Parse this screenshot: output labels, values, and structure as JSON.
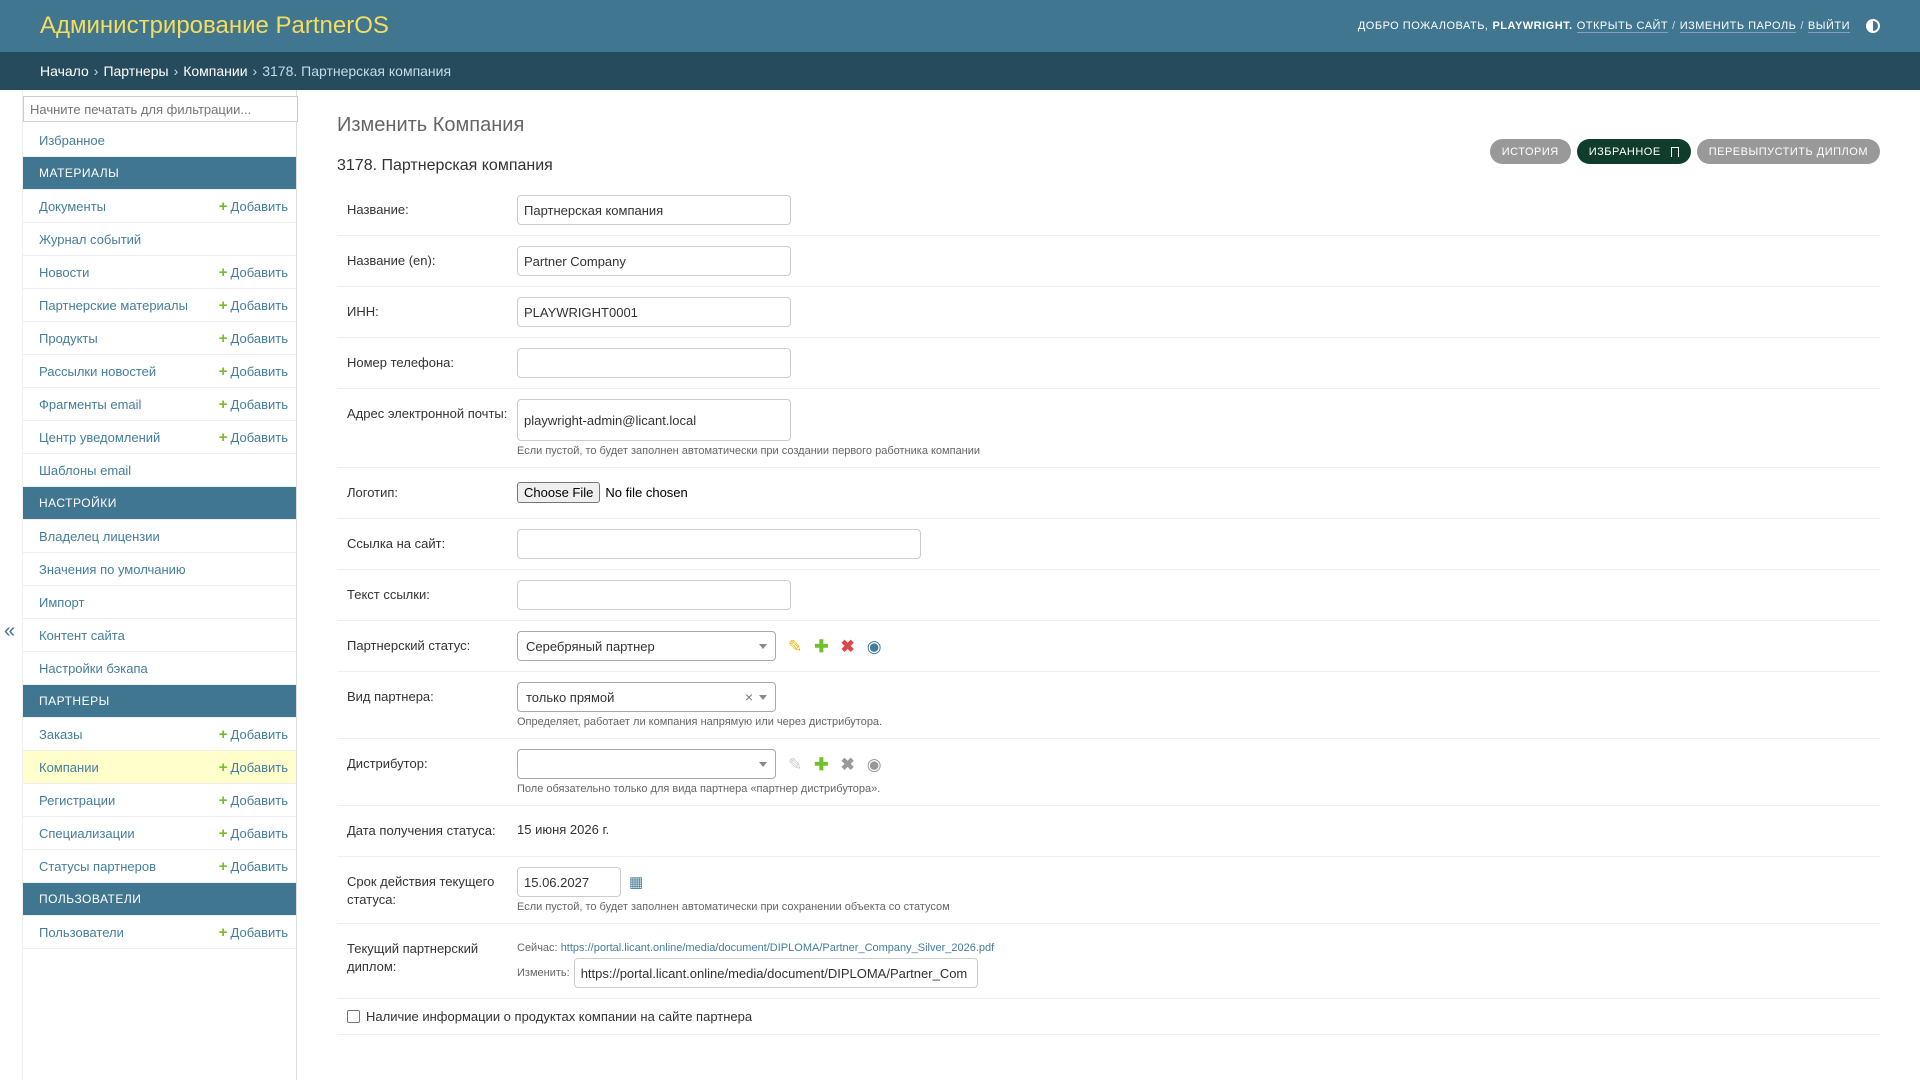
{
  "header": {
    "site_name": "Администрирование PartnerOS",
    "welcome": "ДОБРО ПОЖАЛОВАТЬ,",
    "username": "PLAYWRIGHT.",
    "view_site": "ОТКРЫТЬ САЙТ",
    "change_password": "ИЗМЕНИТЬ ПАРОЛЬ",
    "logout": "ВЫЙТИ",
    "separator": "/"
  },
  "breadcrumbs": {
    "home": "Начало",
    "partners": "Партнеры",
    "companies": "Компании",
    "current": "3178. Партнерская компания",
    "arrow": "›"
  },
  "sidebar": {
    "filter_placeholder": "Начните печатать для фильтрации...",
    "favorites": "Избранное",
    "add_label": "Добавить",
    "sections": {
      "materials": "МАТЕРИАЛЫ",
      "settings": "НАСТРОЙКИ",
      "partners": "ПАРТНЕРЫ",
      "users": "ПОЛЬЗОВАТЕЛИ"
    },
    "materials_items": [
      "Документы",
      "Журнал событий",
      "Новости",
      "Партнерские материалы",
      "Продукты",
      "Рассылки новостей",
      "Фрагменты email",
      "Центр уведомлений",
      "Шаблоны email"
    ],
    "settings_items": [
      "Владелец лицензии",
      "Значения по умолчанию",
      "Импорт",
      "Контент сайта",
      "Настройки бэкапа"
    ],
    "partners_items": [
      "Заказы",
      "Компании",
      "Регистрации",
      "Специализации",
      "Статусы партнеров"
    ],
    "users_items": [
      "Пользователи"
    ],
    "collapse": "«"
  },
  "content": {
    "title": "Изменить Компания",
    "subtitle": "3178. Партнерская компания",
    "tools": {
      "history": "ИСТОРИЯ",
      "favorites": "ИЗБРАННОЕ",
      "reissue": "ПЕРЕВЫПУСТИТЬ ДИПЛОМ"
    },
    "fields": {
      "name_label": "Название:",
      "name_value": "Партнерская компания",
      "name_en_label": "Название (en):",
      "name_en_value": "Partner Company",
      "inn_label": "ИНН:",
      "inn_value": "PLAYWRIGHT0001",
      "phone_label": "Номер телефона:",
      "phone_value": "",
      "email_label": "Адрес электронной почты:",
      "email_value": "playwright-admin@licant.local",
      "email_help": "Если пустой, то будет заполнен автоматически при создании первого работника компании",
      "logo_label": "Логотип:",
      "logo_button": "Choose File",
      "logo_none": "No file chosen",
      "site_label": "Ссылка на сайт:",
      "site_value": "",
      "link_text_label": "Текст ссылки:",
      "link_text_value": "",
      "status_label": "Партнерский статус:",
      "status_value": "Серебряный партнер",
      "kind_label": "Вид партнера:",
      "kind_value": "только прямой",
      "kind_help": "Определяет, работает ли компания напрямую или через дистрибутора.",
      "distributor_label": "Дистрибутор:",
      "distributor_value": "",
      "distributor_help": "Поле обязательно только для вида партнера «партнер дистрибутора».",
      "status_date_label": "Дата получения статуса:",
      "status_date_value": "15 июня 2026 г.",
      "status_expiry_label": "Срок действия текущего статуса:",
      "status_expiry_value": "15.06.2027",
      "status_expiry_help": "Если пустой, то будет заполнен автоматически при сохранении объекта со статусом",
      "diploma_label": "Текущий партнерский диплом:",
      "diploma_current_label": "Сейчас:",
      "diploma_current_url": "https://portal.licant.online/media/document/DIPLOMA/Partner_Company_Silver_2026.pdf",
      "diploma_change_label": "Изменить:",
      "diploma_change_value": "https://portal.licant.online/media/document/DIPLOMA/Partner_Com",
      "products_info_label": "Наличие информации о продуктах компании на сайте партнера"
    }
  }
}
